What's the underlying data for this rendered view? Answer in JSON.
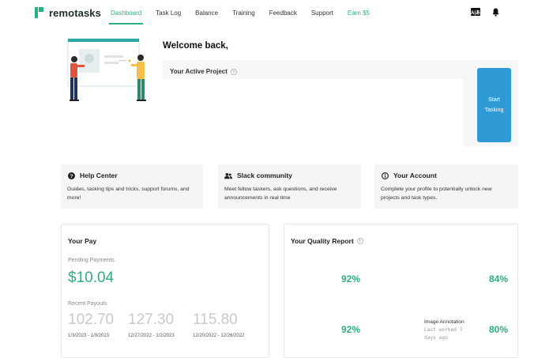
{
  "brand": {
    "name": "remotasks"
  },
  "nav": {
    "links": [
      "Dashboard",
      "Task Log",
      "Balance",
      "Training",
      "Feedback",
      "Support",
      "Earn $5"
    ],
    "active": "Dashboard",
    "lang_badge": "A|あ"
  },
  "welcome": {
    "title": "Welcome back,"
  },
  "active_project": {
    "label": "Your Active Project",
    "start_button_line1": "Start",
    "start_button_line2": "Tasking"
  },
  "cards": [
    {
      "title": "Help Center",
      "icon": "question-circle-icon",
      "desc": "Guides, tasking tips and tricks, support forums, and more!"
    },
    {
      "title": "Slack community",
      "icon": "users-icon",
      "desc": "Meet fellow taskers, ask questions, and receive announcements in real time"
    },
    {
      "title": "Your Account",
      "icon": "info-circle-icon",
      "desc": "Complete your profile to potentially unlock new projects and task types."
    }
  ],
  "pay": {
    "title": "Your Pay",
    "pending_label": "Pending Payments",
    "pending_amount": "$10.04",
    "recent_label": "Recent Payouts",
    "payouts": [
      {
        "amount": "102.70",
        "range": "1/3/2023 - 1/9/2023"
      },
      {
        "amount": "127.30",
        "range": "12/27/2022 - 1/2/2023"
      },
      {
        "amount": "115.80",
        "range": "12/20/2022 - 12/26/2022"
      }
    ]
  },
  "quality": {
    "title": "Your Quality Report",
    "rows": [
      {
        "left_pct": "92%",
        "right_pct": "84%"
      },
      {
        "left_pct": "92%",
        "task_name": "Image Annotation",
        "task_meta_1": "Last worked 7",
        "task_meta_2": "days ago",
        "right_pct": "80%"
      }
    ]
  },
  "colors": {
    "accent_green": "#2fae82",
    "start_button_blue": "#2e9bd6",
    "card_bg": "#f5f5f5"
  }
}
